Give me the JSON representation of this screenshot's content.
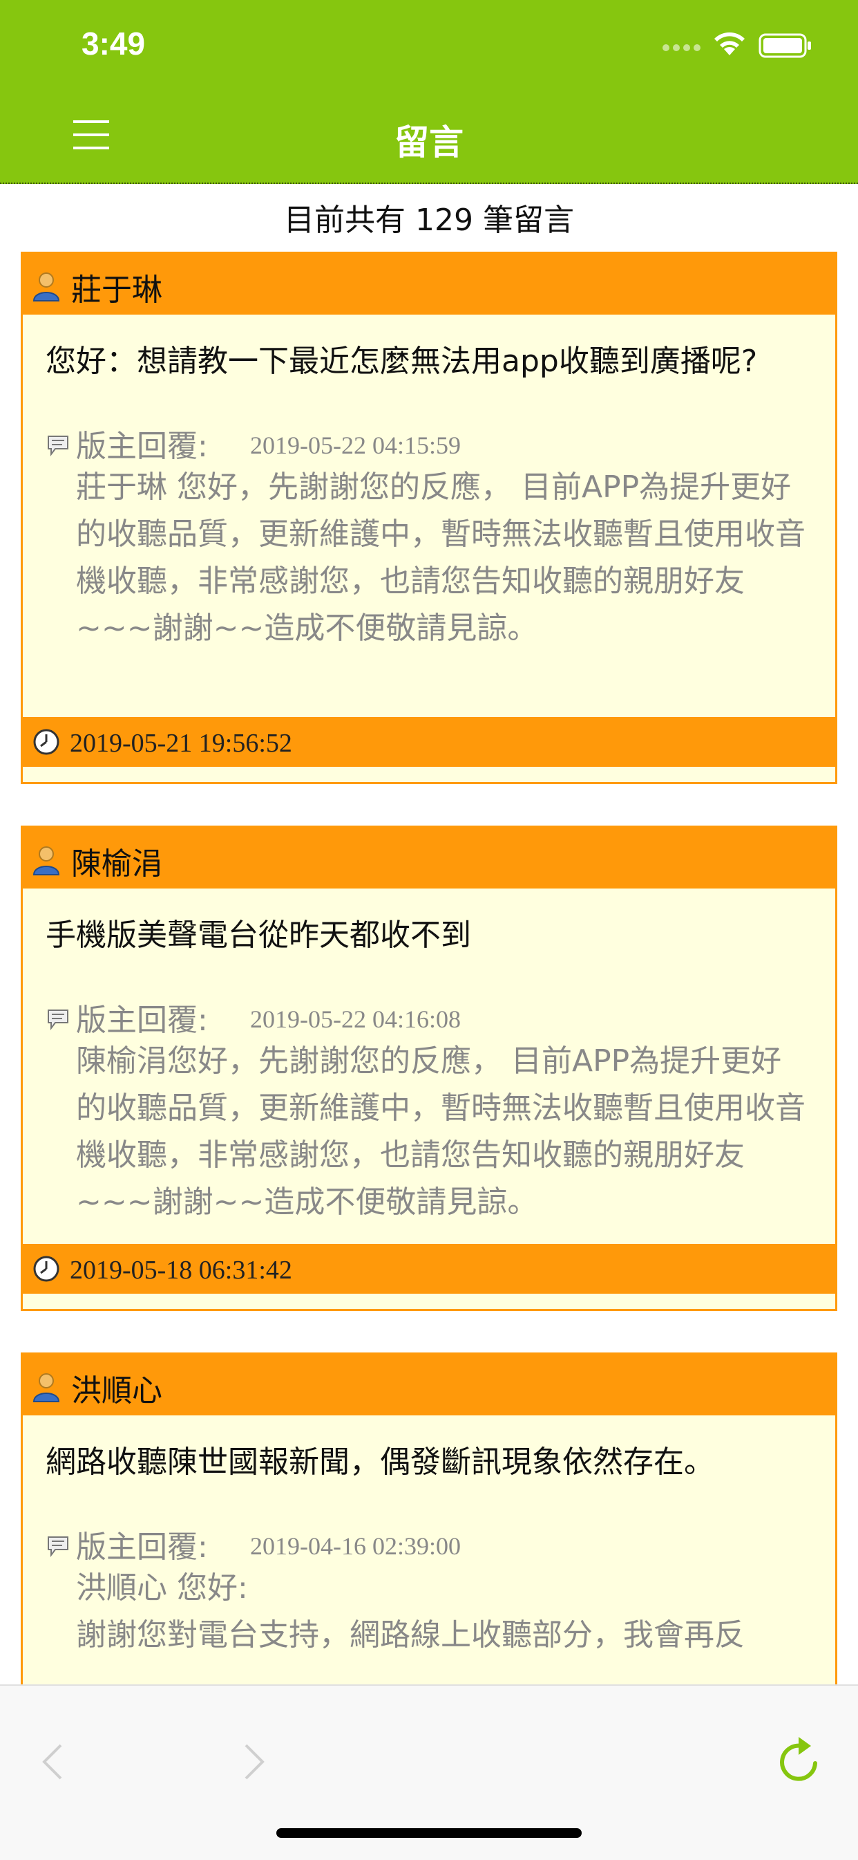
{
  "status": {
    "time": "3:49"
  },
  "nav": {
    "title": "留言"
  },
  "summary": {
    "count_text": "目前共有 129 筆留言"
  },
  "posts": [
    {
      "name": "莊于琳",
      "message": "您好：想請教一下最近怎麼無法用app收聽到廣播呢?",
      "reply_label": "版主回覆:",
      "reply_date": "2019-05-22 04:15:59",
      "reply_text": "莊于琳 您好，先謝謝您的反應， 目前APP為提升更好的收聽品質，更新維護中，暫時無法收聽暫且使用收音機收聽，非常感謝您，也請您告知收聽的親朋好友~~~謝謝~~造成不便敬請見諒。",
      "date": "2019-05-21 19:56:52"
    },
    {
      "name": "陳榆涓",
      "message": "手機版美聲電台從昨天都收不到",
      "reply_label": "版主回覆:",
      "reply_date": "2019-05-22 04:16:08",
      "reply_text": "陳榆涓您好，先謝謝您的反應， 目前APP為提升更好的收聽品質，更新維護中，暫時無法收聽暫且使用收音機收聽，非常感謝您，也請您告知收聽的親朋好友~~~謝謝~~造成不便敬請見諒。",
      "date": "2019-05-18 06:31:42"
    },
    {
      "name": "洪順心",
      "message": "網路收聽陳世國報新聞，偶發斷訊現象依然存在。",
      "reply_label": "版主回覆:",
      "reply_date": "2019-04-16 02:39:00",
      "reply_text": "洪順心 您好:\n謝謝您對電台支持，網路線上收聽部分，我會再反",
      "date": ""
    }
  ],
  "icons": {
    "menu": "hamburger-icon",
    "user": "user-icon",
    "reply": "speech-bubble-icon",
    "clock": "clock-icon",
    "back": "chevron-left-icon",
    "forward": "chevron-right-icon",
    "reload": "reload-icon"
  },
  "colors": {
    "brand_green": "#86c60f",
    "card_orange": "#ff990a",
    "card_bg": "#ffffdf",
    "reply_gray": "#888888"
  }
}
